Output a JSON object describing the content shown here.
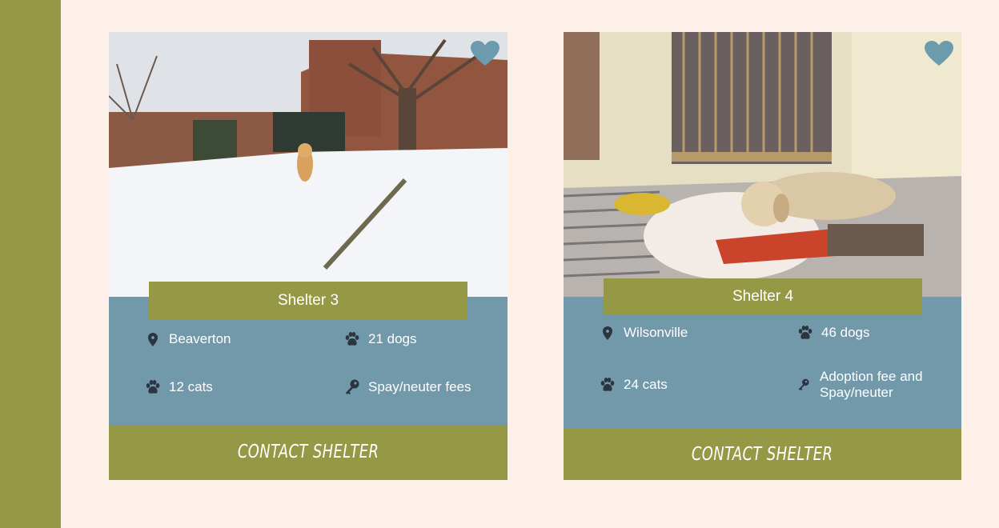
{
  "colors": {
    "page_background": "#fdf0e8",
    "sidebar": "#959945",
    "card_info": "#7199aa",
    "accent_olive": "#959945",
    "heart": "#6c9bad",
    "icon_dark": "#2b3540",
    "text": "#ffffff"
  },
  "shelters": [
    {
      "name": "Shelter 3",
      "location": "Beaverton",
      "dogs": "21 dogs",
      "cats": "12 cats",
      "fees": "Spay/neuter fees",
      "contact_label": "CONTACT SHELTER",
      "icons": {
        "favorite": "heart-icon",
        "location": "map-pin-icon",
        "dogs": "paw-icon",
        "cats": "paw-icon",
        "fees": "key-icon"
      }
    },
    {
      "name": "Shelter 4",
      "location": "Wilsonville",
      "dogs": "46 dogs",
      "cats": "24 cats",
      "fees_line1": "Adoption fee and",
      "fees_line2": "Spay/neuter",
      "contact_label": "CONTACT SHELTER",
      "icons": {
        "favorite": "heart-icon",
        "location": "map-pin-icon",
        "dogs": "paw-icon",
        "cats": "paw-icon",
        "fees": "key-icon"
      }
    }
  ]
}
